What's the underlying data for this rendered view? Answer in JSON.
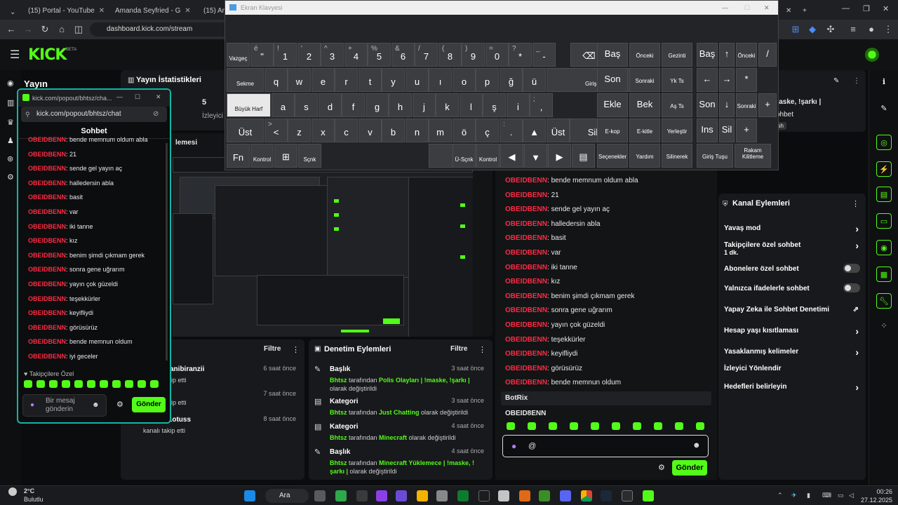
{
  "browser": {
    "tabs": [
      {
        "label": "(15) Portal - YouTube",
        "icon": "youtube-icon"
      },
      {
        "label": "Amanda Seyfried - G",
        "icon": "google-icon"
      },
      {
        "label": "(15) Am",
        "icon": "youtube-icon"
      }
    ],
    "url": "dashboard.kick.com/stream"
  },
  "kick": {
    "logo": "KICK",
    "beta": "BETA",
    "page_title": "Yayın",
    "stats_title": "Yayın İstatistikleri",
    "stats_value": "5",
    "stats_label": "İzleyici",
    "stream_title_partial": "lemesi",
    "accent": "#53fc18"
  },
  "follow_panel": {
    "title": "ıı",
    "filter": "Filtre",
    "rows": [
      {
        "name": "anibiranzii",
        "time": "6 saat önce",
        "desc": "ip etti"
      },
      {
        "name": "",
        "time": "7 saat önce",
        "desc": "ip etti"
      },
      {
        "name": "kusLotuss",
        "time": "8 saat önce",
        "desc": "kanalı takip etti"
      }
    ]
  },
  "mod_panel": {
    "title": "Denetim Eylemleri",
    "filter": "Filtre",
    "rows": [
      {
        "title": "Başlık",
        "time": "3 saat önce",
        "user": "Bhtsz",
        "pre": " tarafından ",
        "value": "Polis Olayları | !maske, !şarkı |",
        "post": " olarak değiştirildi"
      },
      {
        "title": "Kategori",
        "time": "3 saat önce",
        "user": "Bhtsz",
        "pre": " tarafından ",
        "value": "Just Chatting",
        "post": " olarak değiştirildi"
      },
      {
        "title": "Kategori",
        "time": "4 saat önce",
        "user": "Bhtsz",
        "pre": " tarafından ",
        "value": "Minecraft",
        "post": " olarak değiştirildi"
      },
      {
        "title": "Başlık",
        "time": "4 saat önce",
        "user": "Bhtsz",
        "pre": " tarafından ",
        "value": "Minecraft Yüklemece | !maske, !şarkı |",
        "post": " olarak değiştirildi"
      }
    ]
  },
  "right_chat": {
    "messages": [
      {
        "user": "OBEIDBENN",
        "text": ": bende memnum oldum abla"
      },
      {
        "user": "OBEIDBENN",
        "text": ": 21"
      },
      {
        "user": "OBEIDBENN",
        "text": ": sende gel yayın aç"
      },
      {
        "user": "OBEIDBENN",
        "text": ": halledersin abla"
      },
      {
        "user": "OBEIDBENN",
        "text": ": basit"
      },
      {
        "user": "OBEIDBENN",
        "text": ": var"
      },
      {
        "user": "OBEIDBENN",
        "text": ": iki tanne"
      },
      {
        "user": "OBEIDBENN",
        "text": ": kız"
      },
      {
        "user": "OBEIDBENN",
        "text": ": benim şimdi çıkmam gerek"
      },
      {
        "user": "OBEIDBENN",
        "text": ": sonra gene uğrarım"
      },
      {
        "user": "OBEIDBENN",
        "text": ": yayın çok güzeldi"
      },
      {
        "user": "OBEIDBENN",
        "text": ": teşekkürler"
      },
      {
        "user": "OBEIDBENN",
        "text": ": keyifliydi"
      },
      {
        "user": "OBEIDBENN",
        "text": ": görüsürüz"
      },
      {
        "user": "OBEIDBENN",
        "text": ": bende memnun oldum"
      }
    ],
    "botrix": "BotRix",
    "mention_user": "OBEID8ENN",
    "input_value": "@",
    "send": "Gönder",
    "top_info_title": "!maske, !şarkı |",
    "top_info_sub": "ohbet",
    "top_info_badge": "rkish"
  },
  "channel_actions": {
    "title": "Kanal Eylemleri",
    "items": [
      {
        "label": "Yavaş mod",
        "control": "chevron"
      },
      {
        "label": "Takipçilere özel sohbet",
        "sub": "1 dk.",
        "control": "chevron"
      },
      {
        "label": "Abonelere özel sohbet",
        "control": "toggle"
      },
      {
        "label": "Yalnızca ifadelerle sohbet",
        "control": "toggle"
      },
      {
        "label": "Yapay Zeka ile Sohbet Denetimi",
        "control": "external"
      },
      {
        "label": "Hesap yaşı kısıtlaması",
        "control": "chevron"
      },
      {
        "label": "Yasaklanmış kelimeler",
        "control": "chevron"
      },
      {
        "label": "İzleyici Yönlendir",
        "control": "none"
      },
      {
        "label": "Hedefleri belirleyin",
        "control": "chevron"
      }
    ]
  },
  "popout": {
    "window_title": "kick.com/popout/bhtsz/cha...",
    "url": "kick.com/popout/bhtsz/chat",
    "header": "Sohbet",
    "messages": [
      {
        "user": "OBEIDBENN",
        "text": ": bende memnum oldum abla"
      },
      {
        "user": "OBEIDBENN",
        "text": ": 21"
      },
      {
        "user": "OBEIDBENN",
        "text": ": sende gel yayın aç"
      },
      {
        "user": "OBEIDBENN",
        "text": ": halledersin abla"
      },
      {
        "user": "OBEIDBENN",
        "text": ": basit"
      },
      {
        "user": "OBEIDBENN",
        "text": ": var"
      },
      {
        "user": "OBEIDBENN",
        "text": ": iki tanne"
      },
      {
        "user": "OBEIDBENN",
        "text": ": kız"
      },
      {
        "user": "OBEIDBENN",
        "text": ": benim şimdi çıkmam gerek"
      },
      {
        "user": "OBEIDBENN",
        "text": ": sonra gene uğrarım"
      },
      {
        "user": "OBEIDBENN",
        "text": ": yayın çok güzeldi"
      },
      {
        "user": "OBEIDBENN",
        "text": ": teşekkürler"
      },
      {
        "user": "OBEIDBENN",
        "text": ": keyifliydi"
      },
      {
        "user": "OBEIDBENN",
        "text": ": görüsürüz"
      },
      {
        "user": "OBEIDBENN",
        "text": ": bende memnun oldum"
      },
      {
        "user": "OBEIDBENN",
        "text": ": iyi geceler"
      }
    ],
    "footer_label": "Takipçilere Özel",
    "input_placeholder": "Bir mesaj gönderin",
    "send": "Gönder"
  },
  "keyboard": {
    "title": "Ekran Klavyesi",
    "rows": [
      [
        {
          "m": "Vazgeç"
        },
        {
          "s": "é",
          "m": "\""
        },
        {
          "s": "!",
          "m": "1"
        },
        {
          "s": "'",
          "m": "2"
        },
        {
          "s": "^",
          "m": "3"
        },
        {
          "s": "+",
          "m": "4"
        },
        {
          "s": "%",
          "m": "5"
        },
        {
          "s": "&",
          "m": "6"
        },
        {
          "s": "/",
          "m": "7"
        },
        {
          "s": "(",
          "m": "8"
        },
        {
          "s": ")",
          "m": "9"
        },
        {
          "s": "=",
          "m": "0"
        },
        {
          "s": "?",
          "m": "*"
        },
        {
          "s": "_",
          "m": "-"
        },
        {
          "m": "⌫"
        }
      ],
      [
        {
          "m": "Sekme"
        },
        {
          "m": "q"
        },
        {
          "m": "w"
        },
        {
          "m": "e"
        },
        {
          "m": "r"
        },
        {
          "m": "t"
        },
        {
          "m": "y"
        },
        {
          "m": "u"
        },
        {
          "m": "ı"
        },
        {
          "m": "o"
        },
        {
          "m": "p"
        },
        {
          "m": "ğ"
        },
        {
          "m": "ü"
        },
        {
          "m": "Giriş Tuşu"
        }
      ],
      [
        {
          "m": "Büyük Harf"
        },
        {
          "m": "a"
        },
        {
          "m": "s"
        },
        {
          "m": "d"
        },
        {
          "m": "f"
        },
        {
          "m": "g"
        },
        {
          "m": "h"
        },
        {
          "m": "j"
        },
        {
          "m": "k"
        },
        {
          "m": "l"
        },
        {
          "m": "ş"
        },
        {
          "m": "i"
        },
        {
          "s": ";",
          "m": ","
        }
      ],
      [
        {
          "m": "Üst"
        },
        {
          "s": ">",
          "m": "<"
        },
        {
          "m": "z"
        },
        {
          "m": "x"
        },
        {
          "m": "c"
        },
        {
          "m": "v"
        },
        {
          "m": "b"
        },
        {
          "m": "n"
        },
        {
          "m": "m"
        },
        {
          "m": "ö"
        },
        {
          "m": "ç"
        },
        {
          "s": ":",
          "m": "."
        },
        {
          "m": "▲"
        },
        {
          "m": "Üst"
        },
        {
          "m": "Sil"
        }
      ],
      [
        {
          "m": "Fn"
        },
        {
          "m": "Kontrol"
        },
        {
          "m": "⊞"
        },
        {
          "m": "Sçnk"
        },
        {
          "m": ""
        },
        {
          "m": "Ü-Sçnk"
        },
        {
          "m": "Kontrol"
        },
        {
          "m": "◀"
        },
        {
          "m": "▼"
        },
        {
          "m": "▶"
        },
        {
          "m": "▤"
        }
      ]
    ],
    "nav": [
      [
        "Baş",
        "Önceki",
        "Gezinti",
        "Baş",
        "↑",
        "Önceki",
        "/"
      ],
      [
        "Son",
        "Sonraki",
        "Yk Ts",
        "←",
        "→",
        "*",
        ""
      ],
      [
        "Ekle",
        "Bek",
        "Aş Ts",
        "Son",
        "↓",
        "Sonraki",
        "+"
      ],
      [
        "E-kop",
        "E-kitle",
        "Yerleştir",
        "Ins",
        "Sil",
        "+",
        ""
      ],
      [
        "Seçenekler",
        "Yardım",
        "Silinerek",
        "Giriş Tuşu",
        "Rakam Kilitleme",
        "",
        ""
      ]
    ]
  },
  "taskbar": {
    "temp": "2°C",
    "weather": "Bulutlu",
    "search": "Ara",
    "time": "00:26",
    "date": "27.12.2025"
  }
}
